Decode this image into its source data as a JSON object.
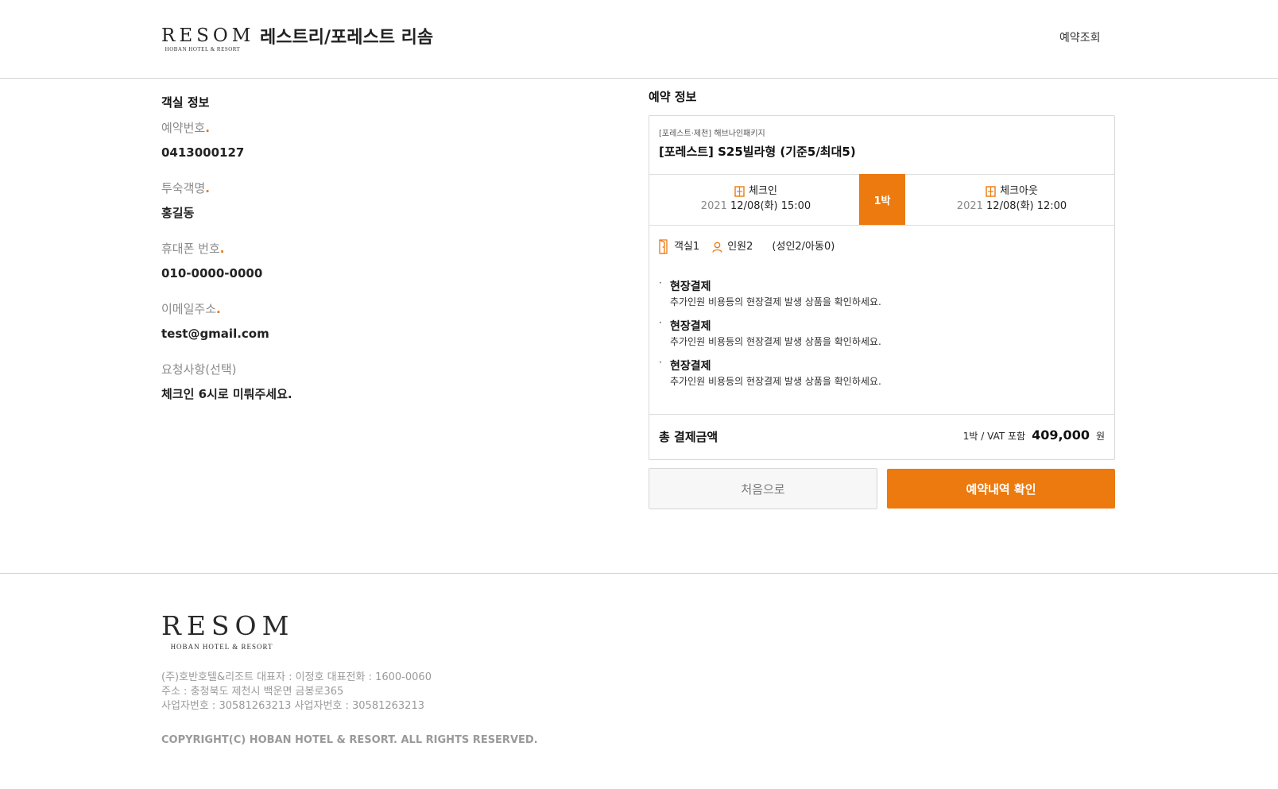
{
  "header": {
    "logo_word": "RESOM",
    "logo_sub": "HOBAN HOTEL & RESORT",
    "title": "레스트리/포레스트 리솜",
    "nav_lookup": "예약조회"
  },
  "room_info": {
    "title": "객실 정보",
    "fields": [
      {
        "label": "예약번호",
        "value": "0413000127",
        "required": true
      },
      {
        "label": "투숙객명",
        "value": "홍길동",
        "required": true
      },
      {
        "label": "휴대폰 번호",
        "value": "010-0000-0000",
        "required": true
      },
      {
        "label": "이메일주소",
        "value": "test@gmail.com",
        "required": true
      },
      {
        "label": "요청사항(선택)",
        "value": "체크인 6시로 미뤄주세요.",
        "required": false
      }
    ],
    "required_mark": "."
  },
  "reservation": {
    "title": "예약 정보",
    "package": "[포레스트·제천] 해브나인패키지",
    "room_name": "[포레스트] S25빌라형 (기준5/최대5)",
    "checkin": {
      "label": "체크인",
      "year": "2021",
      "date": "12/08(화) 15:00"
    },
    "checkout": {
      "label": "체크아웃",
      "year": "2021",
      "date": "12/08(화) 12:00"
    },
    "nights": "1박",
    "rooms": "객실1",
    "guests": "인원2",
    "guest_detail": "(성인2/아동0)",
    "notices": [
      {
        "bullet": "·",
        "title": "현장결제",
        "desc": "추가인원 비용등의 현장결제 발생 상품을 확인하세요."
      },
      {
        "bullet": "·",
        "title": "현장결제",
        "desc": "추가인원 비용등의 현장결제 발생 상품을 확인하세요."
      },
      {
        "bullet": "·",
        "title": "현장결제",
        "desc": "추가인원 비용등의 현장결제 발생 상품을 확인하세요."
      }
    ],
    "total_label": "총 결제금액",
    "total_note": "1박 / VAT 포함",
    "total_amount": "409,000",
    "total_currency": "원"
  },
  "buttons": {
    "home": "처음으로",
    "confirm": "예약내역 확인"
  },
  "footer": {
    "logo_word": "RESOM",
    "logo_sub": "HOBAN HOTEL & RESORT",
    "line1": "(주)호반호텔&리조트 대표자 : 이정호 대표전화 : 1600-0060",
    "line2": "주소 : 충청북도 제천시 백운면 금봉로365",
    "line3": "사업자번호 : 30581263213 사업자번호 : 30581263213",
    "copyright": "COPYRIGHT(C) HOBAN HOTEL & RESORT. ALL RIGHTS RESERVED."
  },
  "colors": {
    "accent": "#ec7a0f",
    "label": "#8a8a8a",
    "border": "#d8d8d8"
  },
  "icons": {
    "checkin": "door-icon",
    "checkout": "door-icon",
    "room": "door-open-icon",
    "guests": "person-icon"
  }
}
